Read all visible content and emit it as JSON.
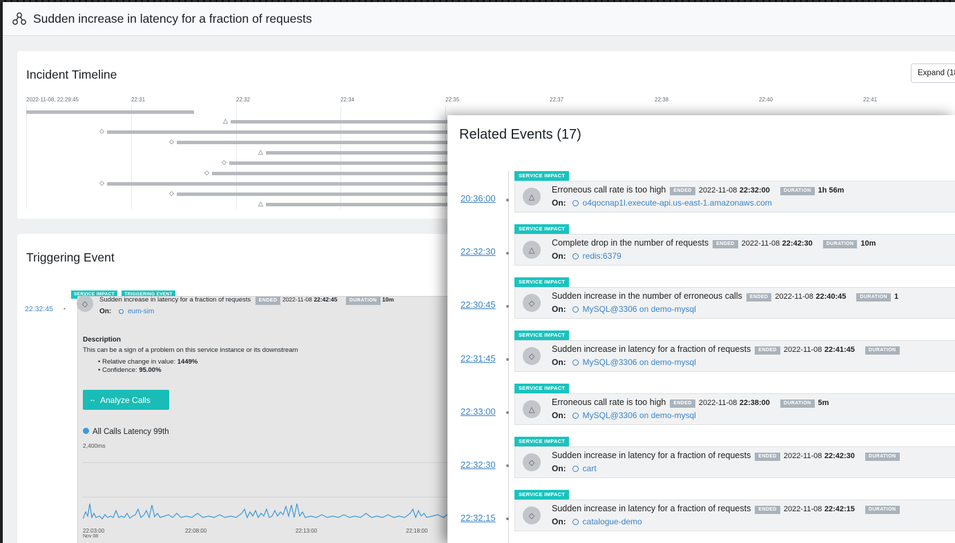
{
  "header": {
    "title": "Sudden increase in latency for a fraction of requests",
    "icon": "service-graph-icon"
  },
  "timeline": {
    "title": "Incident Timeline",
    "expand_label": "Expand (18",
    "ticks": [
      "2022-11-08, 22:29:45",
      "22:31",
      "22:32",
      "22:34",
      "22:35",
      "22:37",
      "22:38",
      "22:40",
      "22:41"
    ]
  },
  "trigger": {
    "title": "Triggering Event",
    "badges": [
      "SERVICE IMPACT",
      "TRIGGERING EVENT"
    ],
    "time": "22:32:45",
    "event_name": "Sudden increase in latency for a fraction of requests",
    "status": "ENDED",
    "end_date": "2022-11-08",
    "end_time": "22:42:45",
    "duration_label": "DURATION",
    "duration": "10m",
    "on_label": "On:",
    "on_target": "eum-sim",
    "description_title": "Description",
    "description": "This can be a sign of a problem on this service instance or its downstream",
    "bullet1_label": "Relative change in value:",
    "bullet1_value": "1449%",
    "bullet2_label": "Confidence:",
    "bullet2_value": "95.00%",
    "analyze_label": "Analyze Calls",
    "chart_legend": "All Calls Latency 99th",
    "chart_ymax_label": "2,400ms",
    "chart_x_labels": [
      "22:03:00",
      "22:08:00",
      "22:13:00",
      "22:18:00"
    ],
    "chart_x_sublabel": "Nov 08",
    "series_color": "#3b9ad9"
  },
  "related": {
    "title": "Related Events (17)",
    "on_label": "On:",
    "ended_label": "ENDED",
    "duration_label": "DURATION",
    "badge": "SERVICE IMPACT",
    "items": [
      {
        "time": "20:36:00",
        "icon": "triangle-icon",
        "name": "Erroneous call rate is too high",
        "date": "2022-11-08",
        "end": "22:32:00",
        "duration": "1h 56m",
        "on": "o4qocnap1l.execute-api.us-east-1.amazonaws.com"
      },
      {
        "time": "22:32:30",
        "icon": "triangle-icon",
        "name": "Complete drop in the number of requests",
        "date": "2022-11-08",
        "end": "22:42:30",
        "duration": "10m",
        "on": "redis:6379"
      },
      {
        "time": "22:30:45",
        "icon": "diamond-icon",
        "name": "Sudden increase in the number of erroneous calls",
        "date": "2022-11-08",
        "end": "22:40:45",
        "duration": "1",
        "on": "MySQL@3306 on demo-mysql"
      },
      {
        "time": "22:31:45",
        "icon": "diamond-icon",
        "name": "Sudden increase in latency for a fraction of requests",
        "date": "2022-11-08",
        "end": "22:41:45",
        "duration": "",
        "on": "MySQL@3306 on demo-mysql"
      },
      {
        "time": "22:33:00",
        "icon": "triangle-icon",
        "name": "Erroneous call rate is too high",
        "date": "2022-11-08",
        "end": "22:38:00",
        "duration": "5m",
        "on": "MySQL@3306 on demo-mysql"
      },
      {
        "time": "22:32:30",
        "icon": "diamond-icon",
        "name": "Sudden increase in latency for a fraction of requests",
        "date": "2022-11-08",
        "end": "22:42:30",
        "duration": "",
        "on": "cart"
      },
      {
        "time": "22:32:15",
        "icon": "diamond-icon",
        "name": "Sudden increase in latency for a fraction of requests",
        "date": "2022-11-08",
        "end": "22:42:15",
        "duration": "",
        "on": "catalogue-demo"
      }
    ]
  }
}
